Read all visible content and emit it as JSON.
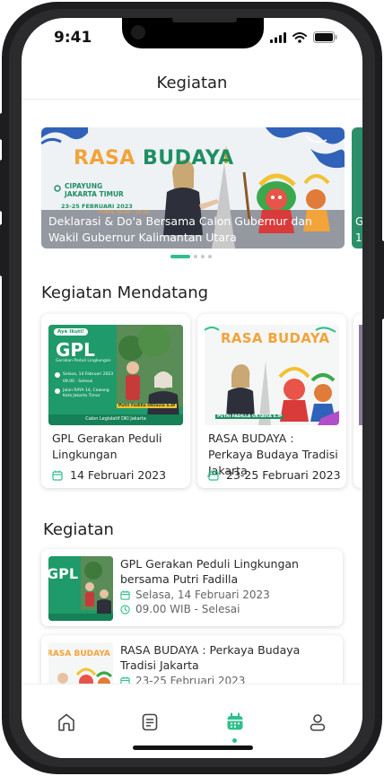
{
  "status": {
    "time": "9:41"
  },
  "header": {
    "title": "Kegiatan"
  },
  "banner": {
    "brand_rasa": "RASA ",
    "brand_budaya": "BUDAYA",
    "location": "CIPAYUNG\nJAKARTA TIMUR",
    "date_text": "23-25 FEBRUARI 2023",
    "time_text": "PUKUL 10.00 - 20.00",
    "caption": "Deklarasi & Do'a Bersama Calon Gubernur dan Wakil Gubernur Kalimantan Utara",
    "next_caption": "G 1("
  },
  "carousel": {
    "count": 4,
    "active": 0
  },
  "upcoming": {
    "title": "Kegiatan Mendatang",
    "items": [
      {
        "title": "GPL Gerakan Peduli Lingkungan",
        "date": "14 Februari 2023",
        "badge": "Aye Ikuti!",
        "logo": "GPL",
        "subtitle": "Gerakan Peduli Lingkungan",
        "detail_date": "Selasa, 14 Februari 2023",
        "detail_time": "09.00 - Selesai",
        "detail_place": "Jalan RAYA 14, Cawang\nKota Jakarta Timur",
        "person": "Putri Fadilla Oktavia S.IP",
        "footer": "Calon Legislatif DKI Jakarta"
      },
      {
        "title": "RASA BUDAYA : Perkaya Budaya Tradisi Jakarta",
        "date": "23-25 Februari 2023",
        "brand": "RASA BUDAYA",
        "person": "PUTRI FADILLA OKTAVIA S.IP"
      }
    ]
  },
  "activities": {
    "title": "Kegiatan",
    "items": [
      {
        "title": "GPL Gerakan Peduli Lingkungan bersama Putri Fadilla",
        "date": "Selasa, 14 Februari 2023",
        "time": "09.00 WIB - Selesai",
        "thumb_logo": "GPL"
      },
      {
        "title": "RASA BUDAYA : Perkaya Budaya Tradisi Jakarta",
        "date": "23-25 Februari 2023",
        "thumb_brand": "RASA BUDAYA"
      }
    ]
  },
  "nav": {
    "items": [
      "home-icon",
      "document-icon",
      "calendar-icon",
      "profile-icon"
    ],
    "active": "calendar-icon"
  },
  "colors": {
    "accent": "#2fbf8a",
    "orange": "#f2a33a",
    "green_dark": "#1f8f63"
  }
}
